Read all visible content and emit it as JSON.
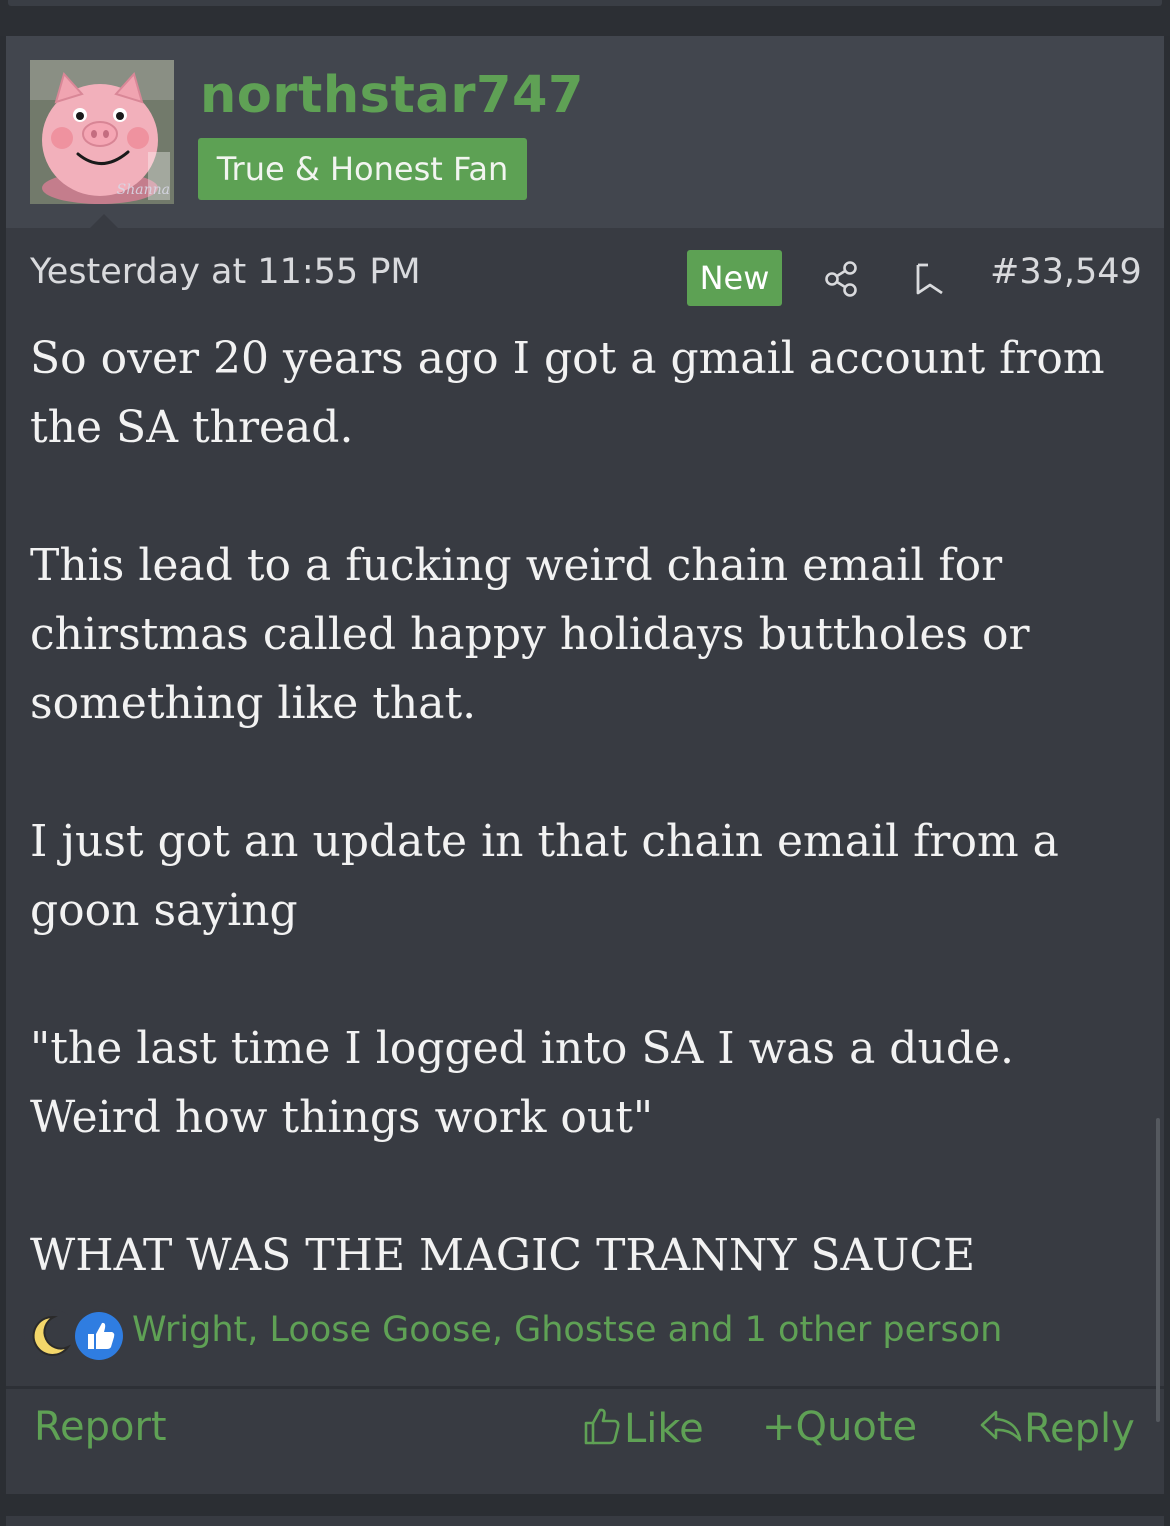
{
  "post": {
    "username": "northstar747",
    "user_title": "True & Honest Fan",
    "avatar_watermark": "Shanna",
    "date": "Yesterday at 11:55 PM",
    "badge": "New",
    "post_number": "#33,549",
    "paragraphs": [
      "So over 20 years ago I got a gmail account from the SA thread.",
      "This lead to a fucking weird chain email for chirstmas called happy holidays buttholes or something like that.",
      "I just got an update in that chain email from a goon saying",
      "\"the last time I logged into SA I was a dude. Weird how things work out\"",
      "WHAT WAS THE MAGIC TRANNY SAUCE"
    ],
    "reactions": {
      "icons": [
        "moon-icon",
        "thumbs-up-icon"
      ],
      "users_text": "Wright, Loose Goose, Ghostse and 1 other person"
    }
  },
  "footer": {
    "report": "Report",
    "like": "Like",
    "quote": "Quote",
    "reply": "Reply"
  },
  "colors": {
    "accent_green": "#5fa155",
    "post_bg": "#383b42",
    "header_bg": "#42464e",
    "page_bg": "#2b2e33"
  }
}
